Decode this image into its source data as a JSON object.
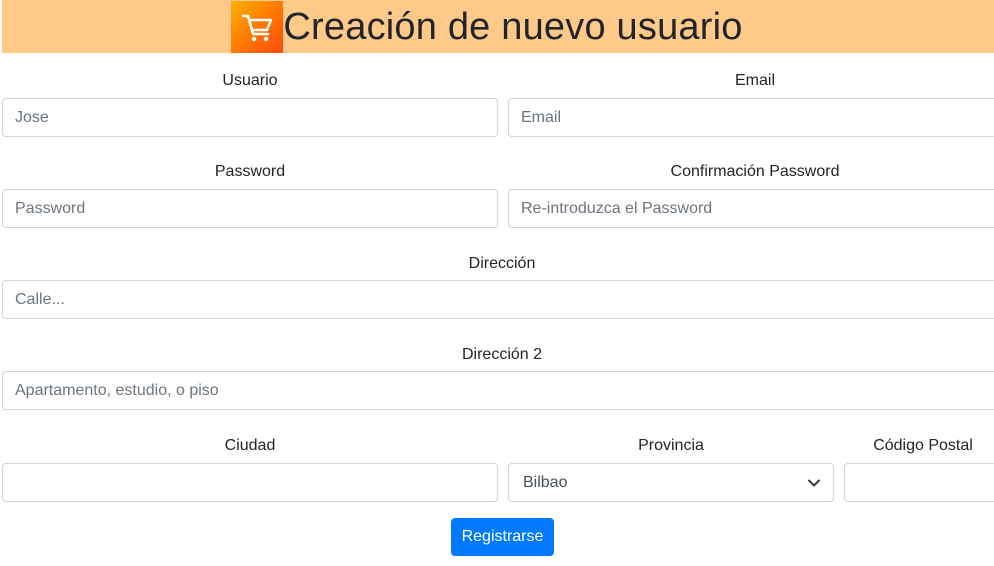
{
  "header": {
    "title": "Creación de nuevo usuario",
    "logo_icon": "shopping-cart-icon",
    "background_color": "#ffc98a"
  },
  "form": {
    "usuario": {
      "label": "Usuario",
      "placeholder": "Jose"
    },
    "email": {
      "label": "Email",
      "placeholder": "Email"
    },
    "password": {
      "label": "Password",
      "placeholder": "Password"
    },
    "password_confirm": {
      "label": "Confirmación Password",
      "placeholder": "Re-introduzca el Password"
    },
    "direccion": {
      "label": "Dirección",
      "placeholder": "Calle..."
    },
    "direccion2": {
      "label": "Dirección 2",
      "placeholder": "Apartamento, estudio, o piso"
    },
    "ciudad": {
      "label": "Ciudad",
      "placeholder": ""
    },
    "provincia": {
      "label": "Provincia",
      "selected": "Bilbao"
    },
    "codigo_postal": {
      "label": "Código Postal",
      "placeholder": ""
    },
    "submit_label": "Registrarse",
    "accent_color": "#007bff"
  }
}
